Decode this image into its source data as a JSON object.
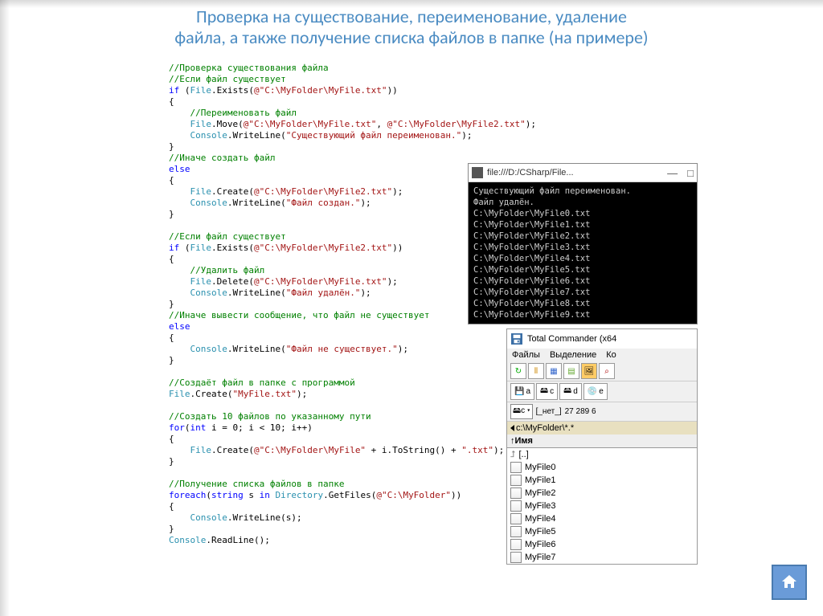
{
  "title_line1": "Проверка на существование, переименование, удаление",
  "title_line2": "файла, а также получение списка файлов в папке (на примере)",
  "code": {
    "c1": "//Проверка существования файла",
    "c2": "//Если файл существует",
    "l3a": "if",
    "l3b": " (",
    "l3c": "File",
    "l3d": ".Exists(",
    "l3e": "@\"C:\\MyFolder\\MyFile.txt\"",
    "l3f": "))",
    "brace_o": "{",
    "brace_c": "}",
    "c4": "//Переименовать файл",
    "l5a": "File",
    "l5b": ".Move(",
    "l5c": "@\"C:\\MyFolder\\MyFile.txt\"",
    "l5d": ", ",
    "l5e": "@\"C:\\MyFolder\\MyFile2.txt\"",
    "l5f": ");",
    "l6a": "Console",
    "l6b": ".WriteLine(",
    "l6c": "\"Существующий файл переименован.\"",
    "l6d": ");",
    "c7": "//Иначе создать файл",
    "else": "else",
    "l8a": "File",
    "l8b": ".Create(",
    "l8c": "@\"C:\\MyFolder\\MyFile2.txt\"",
    "l8d": ");",
    "l9a": "Console",
    "l9b": ".WriteLine(",
    "l9c": "\"Файл создан.\"",
    "l9d": ");",
    "c10": "//Если файл существует",
    "l11a": "if",
    "l11b": " (",
    "l11c": "File",
    "l11d": ".Exists(",
    "l11e": "@\"C:\\MyFolder\\MyFile2.txt\"",
    "l11f": "))",
    "c12": "//Удалить файл",
    "l13a": "File",
    "l13b": ".Delete(",
    "l13c": "@\"C:\\MyFolder\\MyFile.txt\"",
    "l13d": ");",
    "l14a": "Console",
    "l14b": ".WriteLine(",
    "l14c": "\"Файл удалён.\"",
    "l14d": ");",
    "c15": "//Иначе вывести сообщение, что файл не существует",
    "l16a": "Console",
    "l16b": ".WriteLine(",
    "l16c": "\"Файл не существует.\"",
    "l16d": ");",
    "c17": "//Создаёт файл в папке с программой",
    "l18a": "File",
    "l18b": ".Create(",
    "l18c": "\"MyFile.txt\"",
    "l18d": ");",
    "c19": "//Создать 10 файлов по указанному пути",
    "l20a": "for",
    "l20b": "(",
    "l20c": "int",
    "l20d": " i = 0; i < 10; i++)",
    "l21a": "File",
    "l21b": ".Create(",
    "l21c": "@\"C:\\MyFolder\\MyFile\"",
    "l21d": " + i.ToString() + ",
    "l21e": "\".txt\"",
    "l21f": ");",
    "c22": "//Получение списка файлов в папке",
    "l23a": "foreach",
    "l23b": "(",
    "l23c": "string",
    "l23d": " s ",
    "l23e": "in",
    "l23f": " ",
    "l23g": "Directory",
    "l23h": ".GetFiles(",
    "l23i": "@\"C:\\MyFolder\"",
    "l23j": "))",
    "l24a": "Console",
    "l24b": ".WriteLine(s);",
    "l25a": "Console",
    "l25b": ".ReadLine();"
  },
  "console": {
    "title": "file:///D:/CSharp/File...",
    "min": "—",
    "max": "□",
    "lines": [
      "Существующий файл переименован.",
      "Файл удалён.",
      "C:\\MyFolder\\MyFile0.txt",
      "C:\\MyFolder\\MyFile1.txt",
      "C:\\MyFolder\\MyFile2.txt",
      "C:\\MyFolder\\MyFile3.txt",
      "C:\\MyFolder\\MyFile4.txt",
      "C:\\MyFolder\\MyFile5.txt",
      "C:\\MyFolder\\MyFile6.txt",
      "C:\\MyFolder\\MyFile7.txt",
      "C:\\MyFolder\\MyFile8.txt",
      "C:\\MyFolder\\MyFile9.txt"
    ]
  },
  "tc": {
    "title": "Total Commander (x64",
    "menu": [
      "Файлы",
      "Выделение",
      "Ко"
    ],
    "drives": [
      {
        "icon": "a",
        "label": "a"
      },
      {
        "icon": "c",
        "label": "c"
      },
      {
        "icon": "d",
        "label": "d"
      },
      {
        "icon": "e",
        "label": "e"
      }
    ],
    "drivebar": {
      "sel": "c",
      "mid": "[_нет_]",
      "size": "27 289 6"
    },
    "breadcrumb": "c:\\MyFolder\\*.*",
    "header": "↑Имя",
    "up": "[..]",
    "files": [
      "MyFile0",
      "MyFile1",
      "MyFile2",
      "MyFile3",
      "MyFile4",
      "MyFile5",
      "MyFile6",
      "MyFile7"
    ]
  }
}
